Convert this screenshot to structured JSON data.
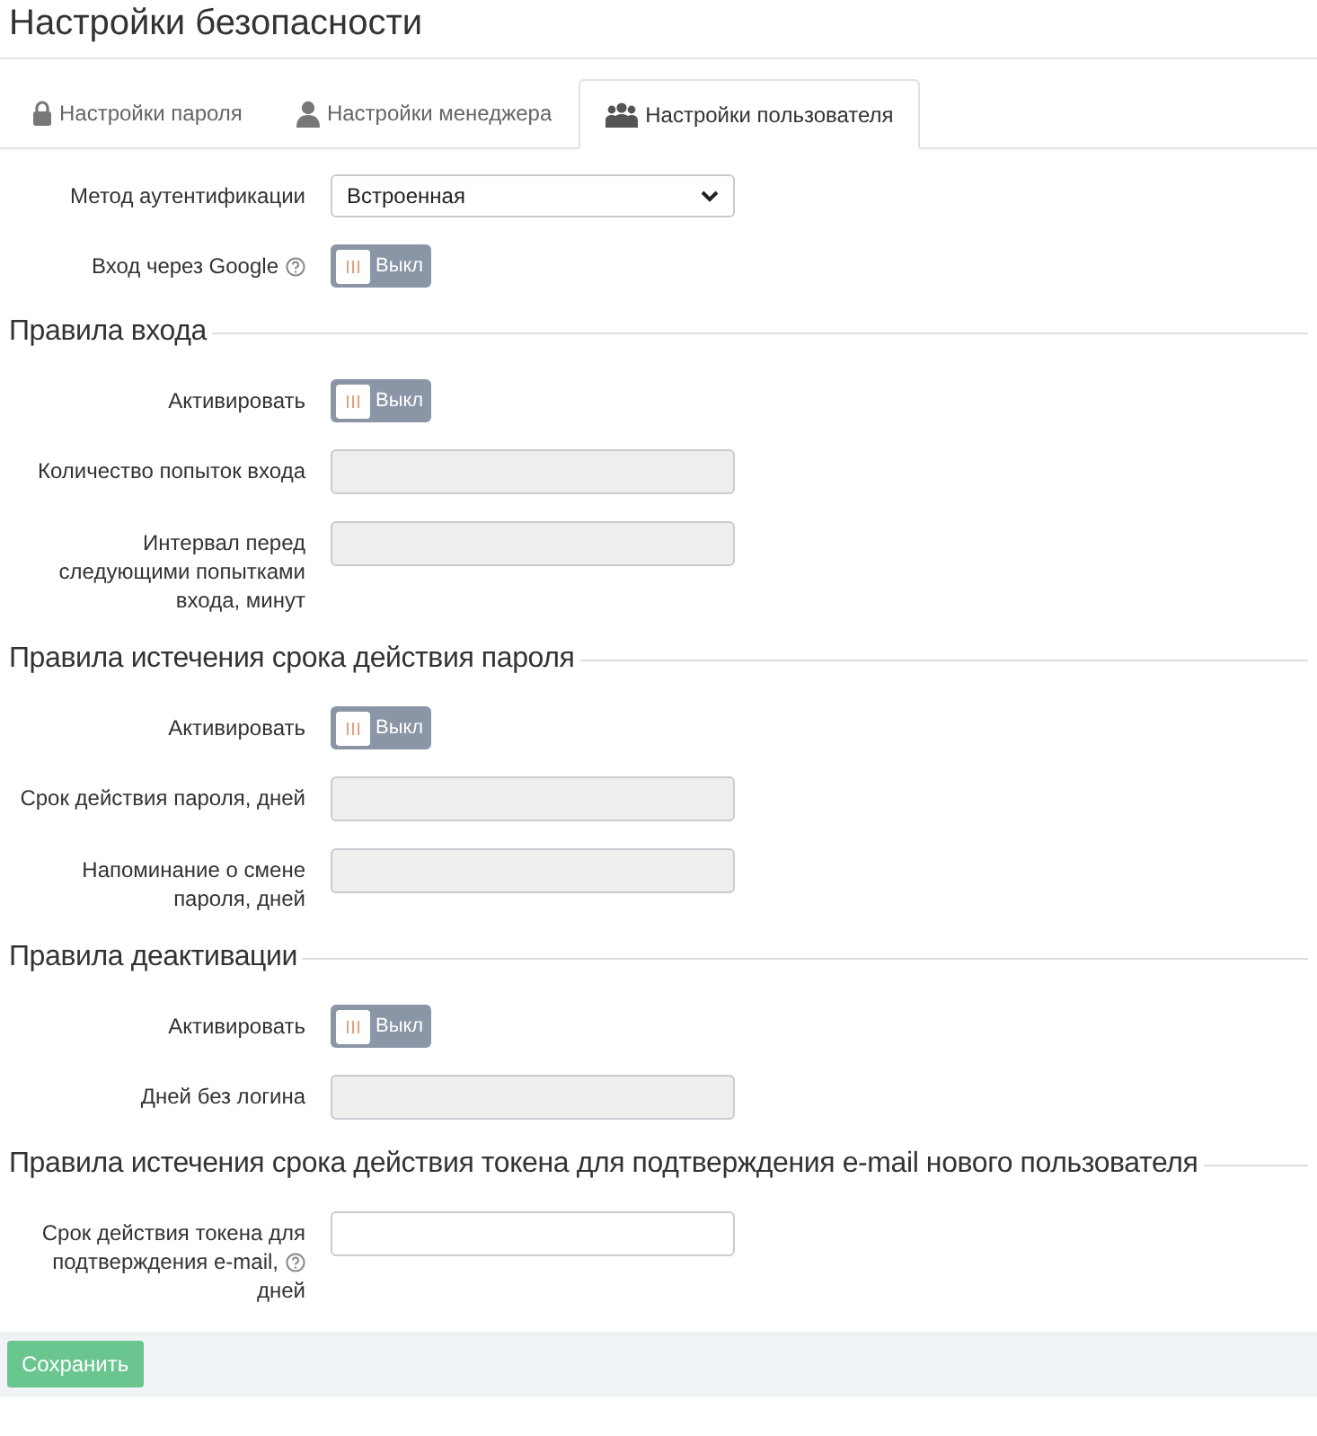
{
  "page_title": "Настройки безопасности",
  "tabs": [
    {
      "label": "Настройки пароля",
      "selected": false
    },
    {
      "label": "Настройки менеджера",
      "selected": false
    },
    {
      "label": "Настройки пользователя",
      "selected": true
    }
  ],
  "sections": [
    {
      "fields": [
        {
          "kind": "select",
          "label": "Метод аутентификации",
          "value": "Встроенная"
        },
        {
          "kind": "toggle",
          "label": "Вход через Google",
          "help": true,
          "on": false,
          "state_text": "Выкл"
        }
      ]
    },
    {
      "heading": "Правила входа",
      "fields": [
        {
          "kind": "toggle",
          "label": "Активировать",
          "on": false,
          "state_text": "Выкл"
        },
        {
          "kind": "input",
          "label": "Количество попыток входа",
          "disabled": true
        },
        {
          "kind": "input",
          "label": "Интервал перед следующими попытками входа, минут",
          "disabled": true
        }
      ]
    },
    {
      "heading": "Правила истечения срока действия пароля",
      "fields": [
        {
          "kind": "toggle",
          "label": "Активировать",
          "on": false,
          "state_text": "Выкл"
        },
        {
          "kind": "input",
          "label": "Срок действия пароля, дней",
          "disabled": true
        },
        {
          "kind": "input",
          "label": "Напоминание о смене пароля, дней",
          "disabled": true
        }
      ]
    },
    {
      "heading": "Правила деактивации",
      "fields": [
        {
          "kind": "toggle",
          "label": "Активировать",
          "on": false,
          "state_text": "Выкл"
        },
        {
          "kind": "input",
          "label": "Дней без логина",
          "disabled": true
        }
      ]
    },
    {
      "heading": "Правила истечения срока действия токена для подтверждения e-mail нового пользователя",
      "fields": [
        {
          "kind": "input",
          "label": "Срок действия токена для подтверждения e-mail,",
          "label_end": "дней",
          "help": true,
          "disabled": false
        }
      ]
    }
  ],
  "save_button": "Сохранить"
}
